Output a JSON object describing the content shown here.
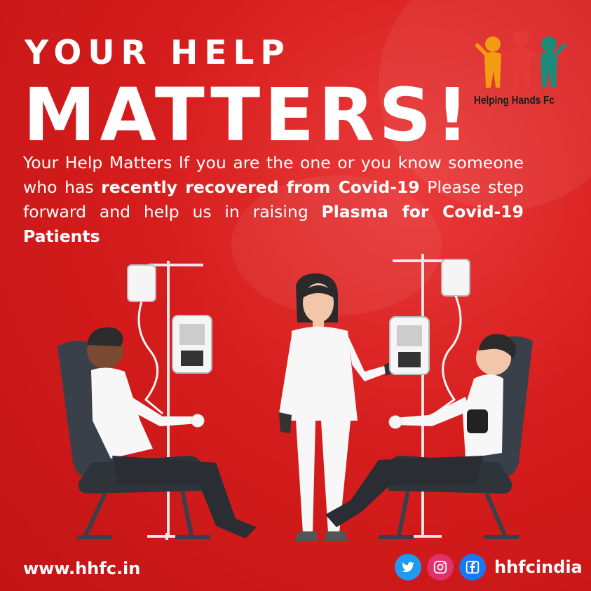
{
  "headline": {
    "line1": "YOUR HELP",
    "line2": "MATTERS!"
  },
  "body": {
    "part1": "Your Help Matters If you are the one or you know someone who has ",
    "bold1": "recently recovered from Covid-19",
    "part2": " Please step forward and help us in raising ",
    "bold2": "Plasma for Covid-19 Patients"
  },
  "logo": {
    "name": "Helping Hands Fc",
    "icon": "people-holding-hands-icon"
  },
  "footer": {
    "url": "www.hhfc.in",
    "handle": "hhfcindia",
    "icons": [
      "twitter-icon",
      "instagram-icon",
      "facebook-icon"
    ]
  },
  "colors": {
    "background": "#d61d1d",
    "text": "#ffffff",
    "twitter": "#1d9bf0",
    "instagram": "#e1306c",
    "facebook": "#1877f2"
  }
}
